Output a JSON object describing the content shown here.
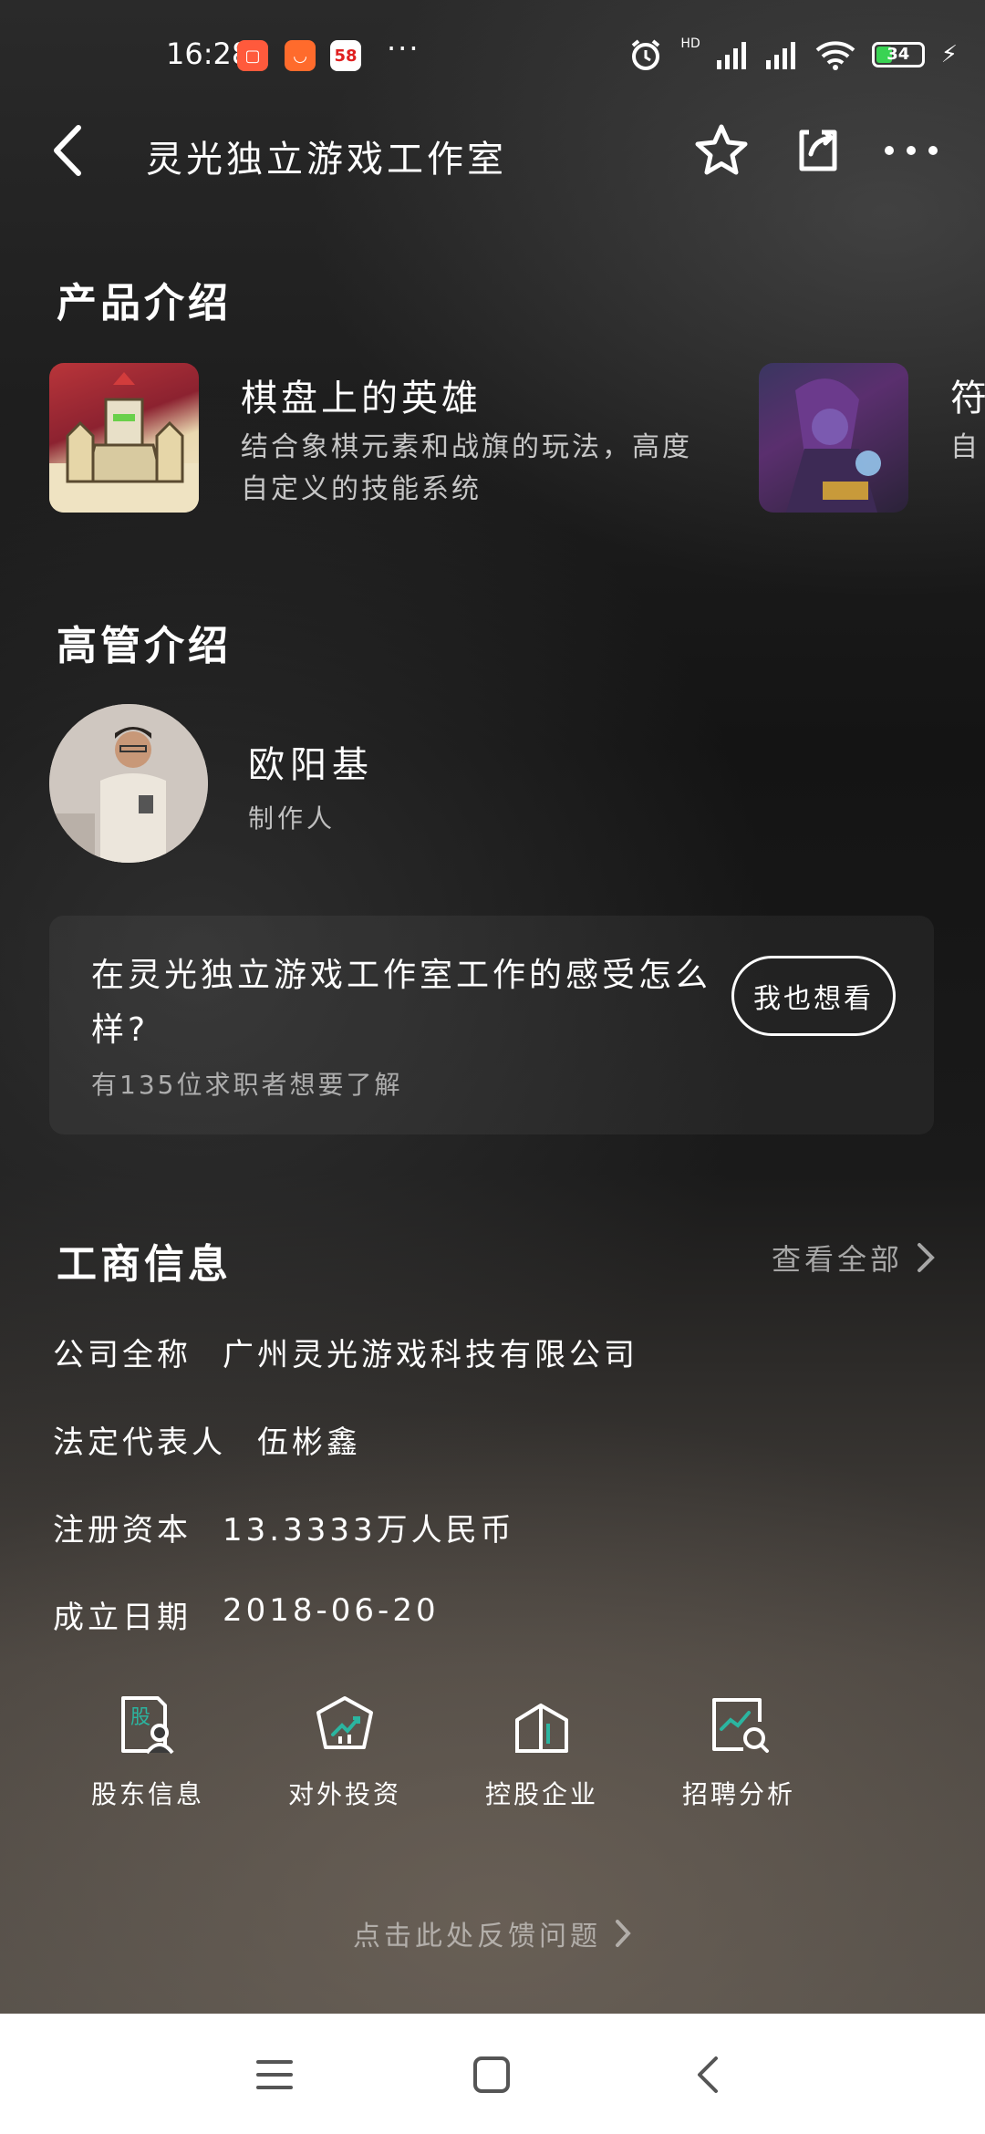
{
  "status_bar": {
    "time": "16:28",
    "app_58": "58",
    "more": "···",
    "battery": "34",
    "signal_tag": "HD"
  },
  "nav": {
    "title": "灵光独立游戏工作室"
  },
  "products": {
    "section_title": "产品介绍",
    "items": [
      {
        "name": "棋盘上的英雄",
        "desc": "结合象棋元素和战旗的玩法，高度自定义的技能系统"
      },
      {
        "name": "符",
        "desc": "自"
      }
    ]
  },
  "executives": {
    "section_title": "高管介绍",
    "items": [
      {
        "name": "欧阳基",
        "role": "制作人"
      }
    ]
  },
  "work_card": {
    "question": "在灵光独立游戏工作室工作的感受怎么样?",
    "sub": "有135位求职者想要了解",
    "button": "我也想看"
  },
  "business": {
    "section_title": "工商信息",
    "view_all": "查看全部",
    "rows": [
      {
        "label": "公司全称",
        "value": "广州灵光游戏科技有限公司"
      },
      {
        "label": "法定代表人",
        "value": "伍彬鑫"
      },
      {
        "label": "注册资本",
        "value": "13.3333万人民币"
      },
      {
        "label": "成立日期",
        "value": "2018-06-20"
      }
    ]
  },
  "quick_actions": [
    {
      "label": "股东信息",
      "icon": "shareholder-icon",
      "icon_text": "股"
    },
    {
      "label": "对外投资",
      "icon": "investment-icon"
    },
    {
      "label": "控股企业",
      "icon": "holding-icon"
    },
    {
      "label": "招聘分析",
      "icon": "recruit-analysis-icon"
    }
  ],
  "feedback": "点击此处反馈问题",
  "colors": {
    "accent_green": "#2bb5a0",
    "battery_green": "#39d353"
  }
}
